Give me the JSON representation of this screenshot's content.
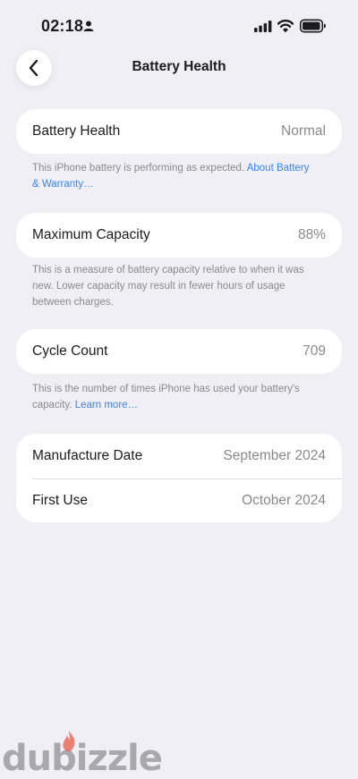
{
  "status_bar": {
    "time": "02:18"
  },
  "nav": {
    "title": "Battery Health",
    "back_icon": "chevron-left-icon"
  },
  "battery_health": {
    "label": "Battery Health",
    "value": "Normal",
    "footnote": "This iPhone battery is performing as expected. ",
    "footnote_link": "About Battery & Warranty…"
  },
  "maximum_capacity": {
    "label": "Maximum Capacity",
    "value": "88%",
    "footnote": "This is a measure of battery capacity relative to when it was new. Lower capacity may result in fewer hours of usage between charges."
  },
  "cycle_count": {
    "label": "Cycle Count",
    "value": "709",
    "footnote": "This is the number of times iPhone has used your battery's capacity. ",
    "footnote_link": "Learn more…"
  },
  "dates": {
    "manufacture_label": "Manufacture Date",
    "manufacture_value": "September 2024",
    "first_use_label": "First Use",
    "first_use_value": "October 2024"
  },
  "watermark": {
    "text": "dubizzle"
  },
  "colors": {
    "background": "#f0eff5",
    "card": "#ffffff",
    "link": "#3b82f6",
    "secondary_text": "#8a8a8e"
  }
}
